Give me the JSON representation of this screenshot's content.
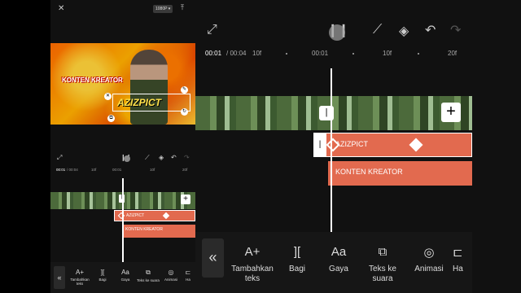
{
  "left": {
    "close_icon": "✕",
    "resolution": "1080P ▾",
    "export_icon": "⤒",
    "preview": {
      "text_konten": "KONTEN KREATOR",
      "text_azizpict": "AZIZPICT"
    },
    "timeline": {
      "current": "00:01",
      "total": "/ 00:04",
      "tick_1": "10f",
      "tick_2": "00:01",
      "tick_3": "10f",
      "tick_4": "20f"
    },
    "tracks": {
      "text_track_1": "AZIZPICT",
      "text_track_2": "KONTEN KREATOR"
    },
    "tools": [
      {
        "icon": "A+",
        "label": "Tambahkan teks"
      },
      {
        "icon": "][",
        "label": "Bagi"
      },
      {
        "icon": "Aa",
        "label": "Gaya"
      },
      {
        "icon": "⧉",
        "label": "Teks ke suara"
      },
      {
        "icon": "◎",
        "label": "Animasi"
      },
      {
        "icon": "⊏",
        "label": "Ha"
      }
    ],
    "collapse_icon": "«"
  },
  "right": {
    "timeline": {
      "current": "00:01",
      "total": "/ 00:04",
      "tick_1": "10f",
      "tick_2": "00:01",
      "tick_3": "10f",
      "tick_4": "20f"
    },
    "tracks": {
      "text_track_1": "AZIZPICT",
      "text_track_2": "KONTEN KREATOR"
    },
    "add_icon": "+",
    "tools": [
      {
        "icon": "A+",
        "label": "Tambahkan teks"
      },
      {
        "icon": "][",
        "label": "Bagi"
      },
      {
        "icon": "Aa",
        "label": "Gaya"
      },
      {
        "icon": "⧉",
        "label": "Teks ke suara"
      },
      {
        "icon": "◎",
        "label": "Animasi"
      },
      {
        "icon": "⊏",
        "label": "Ha"
      }
    ],
    "collapse_icon": "«"
  }
}
